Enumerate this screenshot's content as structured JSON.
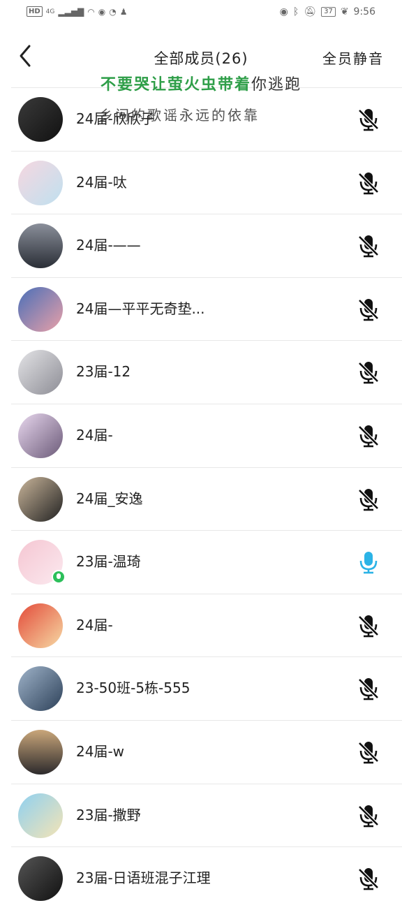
{
  "status_bar": {
    "left_badge": "HD",
    "network": "4G",
    "battery": "37",
    "time": "9:56"
  },
  "header": {
    "title": "全部成员(26)",
    "mute_all": "全员静音"
  },
  "lyrics": {
    "line1_sung": "不要哭让萤火虫带着",
    "line1_rest": "你逃跑",
    "line2": "乡间的歌谣永远的依靠"
  },
  "members": [
    {
      "name": "24届-欣欣子",
      "mic": "muted",
      "avatar_bg": "linear-gradient(135deg,#3a3a3a,#111)"
    },
    {
      "name": "24届-呔",
      "mic": "muted",
      "avatar_bg": "linear-gradient(135deg,#f6d7e0,#bfe0ef)"
    },
    {
      "name": "24届-——",
      "mic": "muted",
      "avatar_bg": "linear-gradient(180deg,#8a8f9a,#2a2e36)"
    },
    {
      "name": "24届—平平无奇垫...",
      "mic": "muted",
      "avatar_bg": "linear-gradient(135deg,#4a6fb8,#e9a0a8)"
    },
    {
      "name": "23届-12",
      "mic": "muted",
      "avatar_bg": "linear-gradient(135deg,#e3e3e6,#8d8d95)"
    },
    {
      "name": "24届-",
      "mic": "muted",
      "avatar_bg": "linear-gradient(135deg,#e8d7ee,#6b5a78)"
    },
    {
      "name": "24届_安逸",
      "mic": "muted",
      "avatar_bg": "linear-gradient(135deg,#c9b59a,#222)"
    },
    {
      "name": "23届-温琦",
      "mic": "active",
      "avatar_bg": "linear-gradient(135deg,#f5c6d2,#fbe9ef)"
    },
    {
      "name": "24届-",
      "mic": "muted",
      "avatar_bg": "linear-gradient(135deg,#e34b3a,#f6d9a4)"
    },
    {
      "name": "23-50班-5栋-555",
      "mic": "muted",
      "avatar_bg": "linear-gradient(135deg,#9fb3c9,#2d4159)"
    },
    {
      "name": "24届-w",
      "mic": "muted",
      "avatar_bg": "linear-gradient(180deg,#c9a67a,#2c2a2c)"
    },
    {
      "name": "23届-撒野",
      "mic": "muted",
      "avatar_bg": "linear-gradient(135deg,#8fd0f0,#f4e4b5)"
    },
    {
      "name": "23届-日语班混子江理",
      "mic": "muted",
      "avatar_bg": "linear-gradient(135deg,#555,#111)"
    }
  ],
  "colors": {
    "accent_mic": "#2bb3e6",
    "speaking_badge": "#2cbf5a",
    "lyric_green": "#2e9e48"
  }
}
